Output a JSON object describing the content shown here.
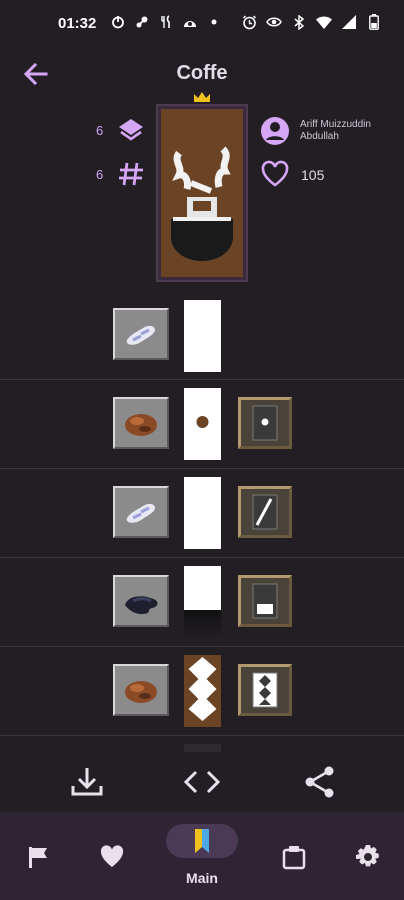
{
  "status_bar": {
    "time": "01:32"
  },
  "app_bar": {
    "title": "Coffe",
    "back_icon": "arrow-left-icon"
  },
  "banner_info": {
    "layers_count": "6",
    "patterns_count": "6",
    "author": "Ariff Muizzuddin Abdullah",
    "likes": "105"
  },
  "steps": [
    {
      "dye": "white-dye",
      "pattern": "base",
      "preview": "white"
    },
    {
      "dye": "brown-dye",
      "pattern": "circle",
      "preview": "circle"
    },
    {
      "dye": "white-dye",
      "pattern": "diagonal",
      "preview": "white"
    },
    {
      "dye": "black-dye",
      "pattern": "bottom-stripe",
      "preview": "bottom-fade"
    },
    {
      "dye": "brown-dye",
      "pattern": "border-zigzag",
      "preview": "zigzag"
    }
  ],
  "actions": {
    "download_icon": "download-icon",
    "code_icon": "code-icon",
    "share_icon": "share-icon"
  },
  "nav": {
    "items": [
      {
        "name": "flag-icon",
        "label": ""
      },
      {
        "name": "heart-icon",
        "label": ""
      },
      {
        "name": "bookmark-icon",
        "label": "Main"
      },
      {
        "name": "clipboard-icon",
        "label": ""
      },
      {
        "name": "settings-icon",
        "label": ""
      }
    ],
    "active_label": "Main"
  },
  "colors": {
    "background": "#221e24",
    "accent": "#d4a6f4",
    "nav_background": "#2d2533",
    "banner_brown": "#6b4426",
    "crown": "#f2c21c"
  }
}
